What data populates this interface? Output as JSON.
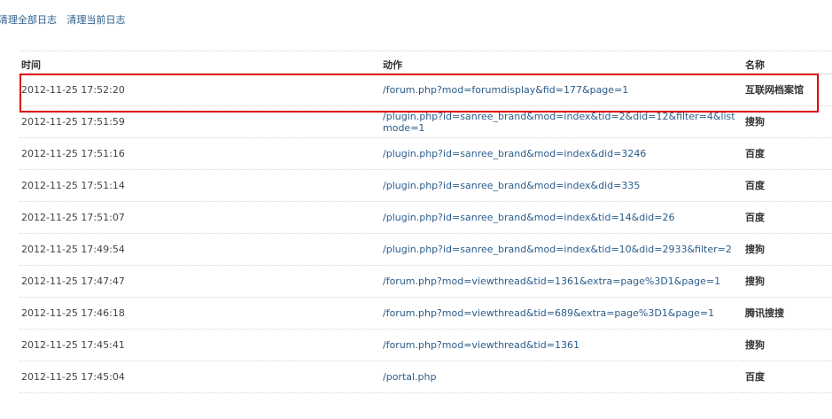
{
  "top_links": {
    "clear_all": "清理全部日志",
    "clear_current": "清理当前日志"
  },
  "table": {
    "headers": {
      "time": "时间",
      "action": "动作",
      "name": "名称"
    },
    "rows": [
      {
        "time": "2012-11-25 17:52:20",
        "action": "/forum.php?mod=forumdisplay&fid=177&page=1",
        "name": "互联网档案馆"
      },
      {
        "time": "2012-11-25 17:51:59",
        "action": "/plugin.php?id=sanree_brand&mod=index&tid=2&did=12&filter=4&listmode=1",
        "name": "搜狗"
      },
      {
        "time": "2012-11-25 17:51:16",
        "action": "/plugin.php?id=sanree_brand&mod=index&did=3246",
        "name": "百度"
      },
      {
        "time": "2012-11-25 17:51:14",
        "action": "/plugin.php?id=sanree_brand&mod=index&did=335",
        "name": "百度"
      },
      {
        "time": "2012-11-25 17:51:07",
        "action": "/plugin.php?id=sanree_brand&mod=index&tid=14&did=26",
        "name": "百度"
      },
      {
        "time": "2012-11-25 17:49:54",
        "action": "/plugin.php?id=sanree_brand&mod=index&tid=10&did=2933&filter=2",
        "name": "搜狗"
      },
      {
        "time": "2012-11-25 17:47:47",
        "action": "/forum.php?mod=viewthread&tid=1361&extra=page%3D1&page=1",
        "name": "搜狗"
      },
      {
        "time": "2012-11-25 17:46:18",
        "action": "/forum.php?mod=viewthread&tid=689&extra=page%3D1&page=1",
        "name": "腾讯搜搜"
      },
      {
        "time": "2012-11-25 17:45:41",
        "action": "/forum.php?mod=viewthread&tid=1361",
        "name": "搜狗"
      },
      {
        "time": "2012-11-25 17:45:04",
        "action": "/portal.php",
        "name": "百度"
      }
    ]
  },
  "colors": {
    "link": "#2b5c8a",
    "highlight": "#dd0000"
  }
}
